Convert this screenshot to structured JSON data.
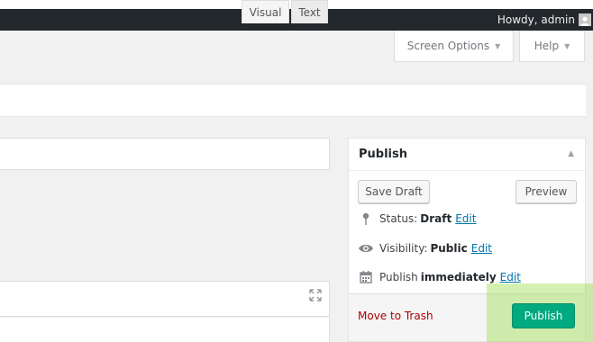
{
  "admin_bar": {
    "greeting": "Howdy, admin"
  },
  "screen_meta": {
    "screen_options_label": "Screen Options",
    "help_label": "Help",
    "arrow_glyph": "▼"
  },
  "editor": {
    "tab_visual": "Visual",
    "tab_text": "Text",
    "fullscreen_icon": "fullscreen-icon"
  },
  "publish_box": {
    "title": "Publish",
    "toggle_glyph": "▲",
    "save_draft_label": "Save Draft",
    "preview_label": "Preview",
    "status_label": "Status:",
    "status_value": "Draft",
    "visibility_label": "Visibility:",
    "visibility_value": "Public",
    "schedule_label": "Publish",
    "schedule_value": "immediately",
    "edit_label": "Edit",
    "trash_label": "Move to Trash",
    "publish_label": "Publish",
    "icons": [
      "pin-icon",
      "eye-icon",
      "calendar-icon"
    ]
  },
  "colors": {
    "admin_bar": "#23282d",
    "link": "#0073aa",
    "trash": "#aa0000",
    "publish_button": "#00a97f",
    "highlight": "#96dc3c"
  }
}
